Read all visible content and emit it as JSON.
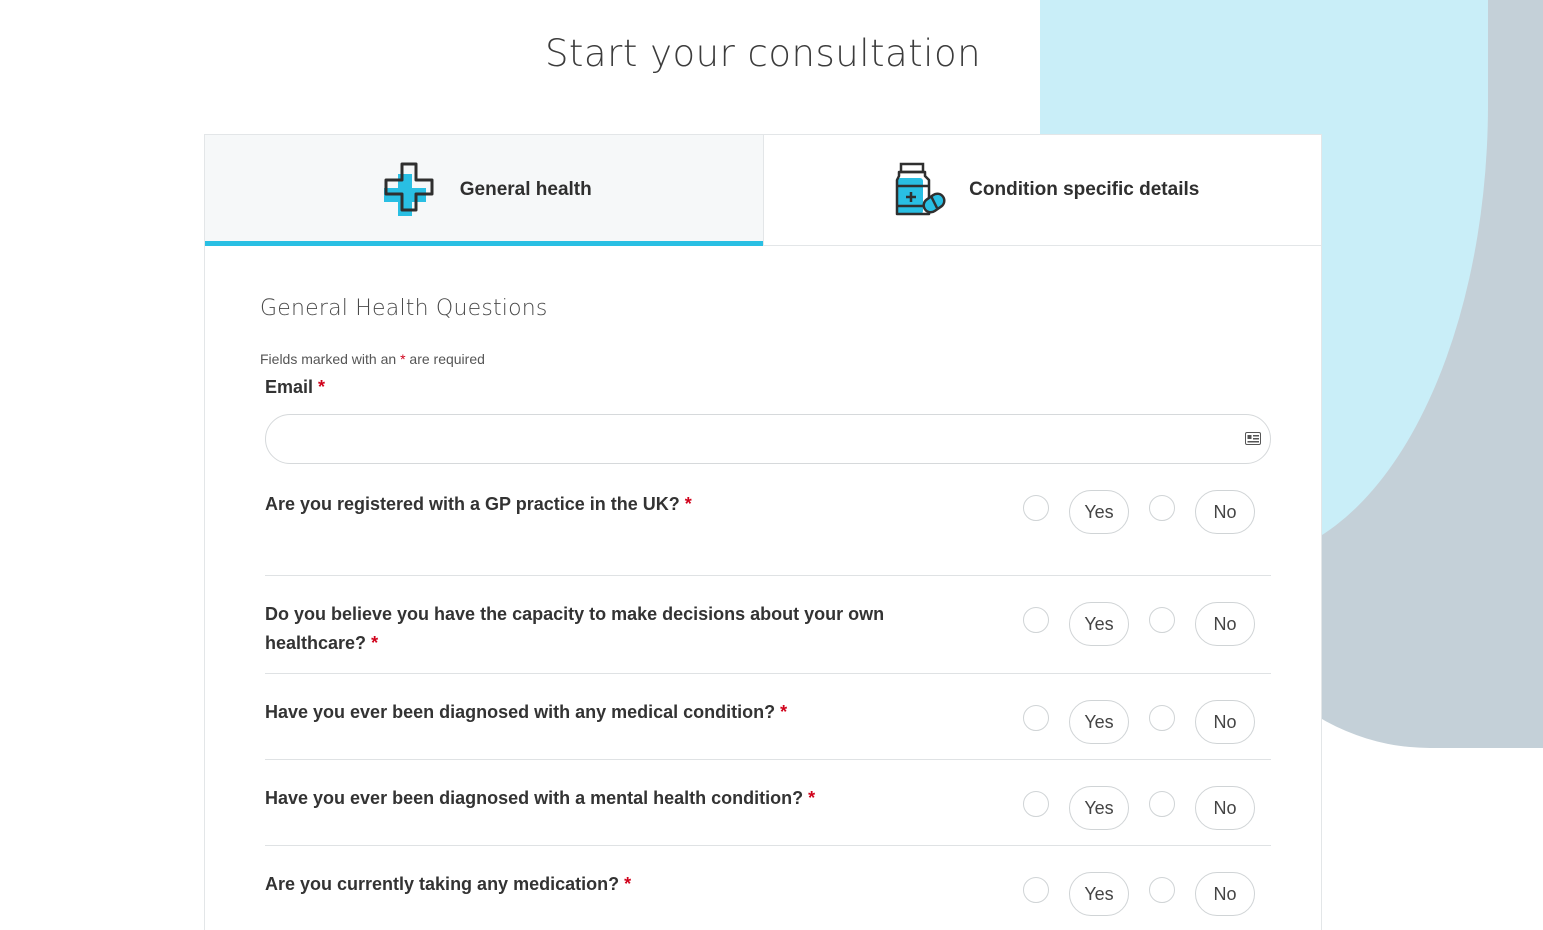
{
  "page": {
    "title": "Start your consultation"
  },
  "tabs": [
    {
      "label": "General health",
      "icon": "medical-cross-icon",
      "active": true
    },
    {
      "label": "Condition specific details",
      "icon": "medicine-bottle-icon",
      "active": false
    }
  ],
  "form": {
    "section_title": "General Health Questions",
    "required_note_prefix": "Fields marked with an",
    "required_note_star": "*",
    "required_note_suffix": "are required",
    "email_label": "Email",
    "email_value": "",
    "required_star": "*",
    "questions": [
      {
        "text": "Are you registered with a GP practice in the UK?",
        "yes": "Yes",
        "no": "No"
      },
      {
        "text": "Do you believe you have the capacity to make decisions about your own healthcare?",
        "yes": "Yes",
        "no": "No"
      },
      {
        "text": "Have you ever been diagnosed with any medical condition?",
        "yes": "Yes",
        "no": "No"
      },
      {
        "text": "Have you ever been diagnosed with a mental health condition?",
        "yes": "Yes",
        "no": "No"
      },
      {
        "text": "Are you currently taking any medication?",
        "yes": "Yes",
        "no": "No"
      }
    ]
  },
  "colors": {
    "accent": "#29bfe3",
    "required": "#d0021b",
    "blob_blue": "#c9eef8",
    "blob_gray": "#c4d0d8"
  }
}
